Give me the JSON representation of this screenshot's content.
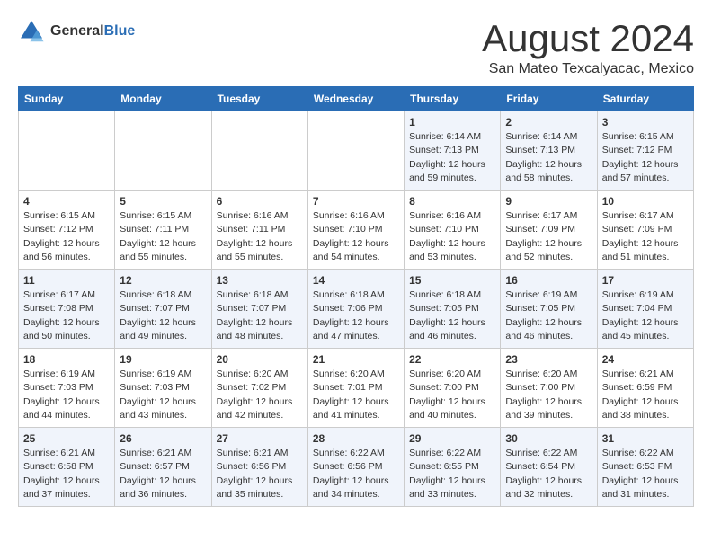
{
  "logo": {
    "general": "General",
    "blue": "Blue"
  },
  "title": "August 2024",
  "location": "San Mateo Texcalyacac, Mexico",
  "days_header": [
    "Sunday",
    "Monday",
    "Tuesday",
    "Wednesday",
    "Thursday",
    "Friday",
    "Saturday"
  ],
  "weeks": [
    [
      {
        "day": "",
        "info": ""
      },
      {
        "day": "",
        "info": ""
      },
      {
        "day": "",
        "info": ""
      },
      {
        "day": "",
        "info": ""
      },
      {
        "day": "1",
        "info": "Sunrise: 6:14 AM\nSunset: 7:13 PM\nDaylight: 12 hours\nand 59 minutes."
      },
      {
        "day": "2",
        "info": "Sunrise: 6:14 AM\nSunset: 7:13 PM\nDaylight: 12 hours\nand 58 minutes."
      },
      {
        "day": "3",
        "info": "Sunrise: 6:15 AM\nSunset: 7:12 PM\nDaylight: 12 hours\nand 57 minutes."
      }
    ],
    [
      {
        "day": "4",
        "info": "Sunrise: 6:15 AM\nSunset: 7:12 PM\nDaylight: 12 hours\nand 56 minutes."
      },
      {
        "day": "5",
        "info": "Sunrise: 6:15 AM\nSunset: 7:11 PM\nDaylight: 12 hours\nand 55 minutes."
      },
      {
        "day": "6",
        "info": "Sunrise: 6:16 AM\nSunset: 7:11 PM\nDaylight: 12 hours\nand 55 minutes."
      },
      {
        "day": "7",
        "info": "Sunrise: 6:16 AM\nSunset: 7:10 PM\nDaylight: 12 hours\nand 54 minutes."
      },
      {
        "day": "8",
        "info": "Sunrise: 6:16 AM\nSunset: 7:10 PM\nDaylight: 12 hours\nand 53 minutes."
      },
      {
        "day": "9",
        "info": "Sunrise: 6:17 AM\nSunset: 7:09 PM\nDaylight: 12 hours\nand 52 minutes."
      },
      {
        "day": "10",
        "info": "Sunrise: 6:17 AM\nSunset: 7:09 PM\nDaylight: 12 hours\nand 51 minutes."
      }
    ],
    [
      {
        "day": "11",
        "info": "Sunrise: 6:17 AM\nSunset: 7:08 PM\nDaylight: 12 hours\nand 50 minutes."
      },
      {
        "day": "12",
        "info": "Sunrise: 6:18 AM\nSunset: 7:07 PM\nDaylight: 12 hours\nand 49 minutes."
      },
      {
        "day": "13",
        "info": "Sunrise: 6:18 AM\nSunset: 7:07 PM\nDaylight: 12 hours\nand 48 minutes."
      },
      {
        "day": "14",
        "info": "Sunrise: 6:18 AM\nSunset: 7:06 PM\nDaylight: 12 hours\nand 47 minutes."
      },
      {
        "day": "15",
        "info": "Sunrise: 6:18 AM\nSunset: 7:05 PM\nDaylight: 12 hours\nand 46 minutes."
      },
      {
        "day": "16",
        "info": "Sunrise: 6:19 AM\nSunset: 7:05 PM\nDaylight: 12 hours\nand 46 minutes."
      },
      {
        "day": "17",
        "info": "Sunrise: 6:19 AM\nSunset: 7:04 PM\nDaylight: 12 hours\nand 45 minutes."
      }
    ],
    [
      {
        "day": "18",
        "info": "Sunrise: 6:19 AM\nSunset: 7:03 PM\nDaylight: 12 hours\nand 44 minutes."
      },
      {
        "day": "19",
        "info": "Sunrise: 6:19 AM\nSunset: 7:03 PM\nDaylight: 12 hours\nand 43 minutes."
      },
      {
        "day": "20",
        "info": "Sunrise: 6:20 AM\nSunset: 7:02 PM\nDaylight: 12 hours\nand 42 minutes."
      },
      {
        "day": "21",
        "info": "Sunrise: 6:20 AM\nSunset: 7:01 PM\nDaylight: 12 hours\nand 41 minutes."
      },
      {
        "day": "22",
        "info": "Sunrise: 6:20 AM\nSunset: 7:00 PM\nDaylight: 12 hours\nand 40 minutes."
      },
      {
        "day": "23",
        "info": "Sunrise: 6:20 AM\nSunset: 7:00 PM\nDaylight: 12 hours\nand 39 minutes."
      },
      {
        "day": "24",
        "info": "Sunrise: 6:21 AM\nSunset: 6:59 PM\nDaylight: 12 hours\nand 38 minutes."
      }
    ],
    [
      {
        "day": "25",
        "info": "Sunrise: 6:21 AM\nSunset: 6:58 PM\nDaylight: 12 hours\nand 37 minutes."
      },
      {
        "day": "26",
        "info": "Sunrise: 6:21 AM\nSunset: 6:57 PM\nDaylight: 12 hours\nand 36 minutes."
      },
      {
        "day": "27",
        "info": "Sunrise: 6:21 AM\nSunset: 6:56 PM\nDaylight: 12 hours\nand 35 minutes."
      },
      {
        "day": "28",
        "info": "Sunrise: 6:22 AM\nSunset: 6:56 PM\nDaylight: 12 hours\nand 34 minutes."
      },
      {
        "day": "29",
        "info": "Sunrise: 6:22 AM\nSunset: 6:55 PM\nDaylight: 12 hours\nand 33 minutes."
      },
      {
        "day": "30",
        "info": "Sunrise: 6:22 AM\nSunset: 6:54 PM\nDaylight: 12 hours\nand 32 minutes."
      },
      {
        "day": "31",
        "info": "Sunrise: 6:22 AM\nSunset: 6:53 PM\nDaylight: 12 hours\nand 31 minutes."
      }
    ]
  ]
}
